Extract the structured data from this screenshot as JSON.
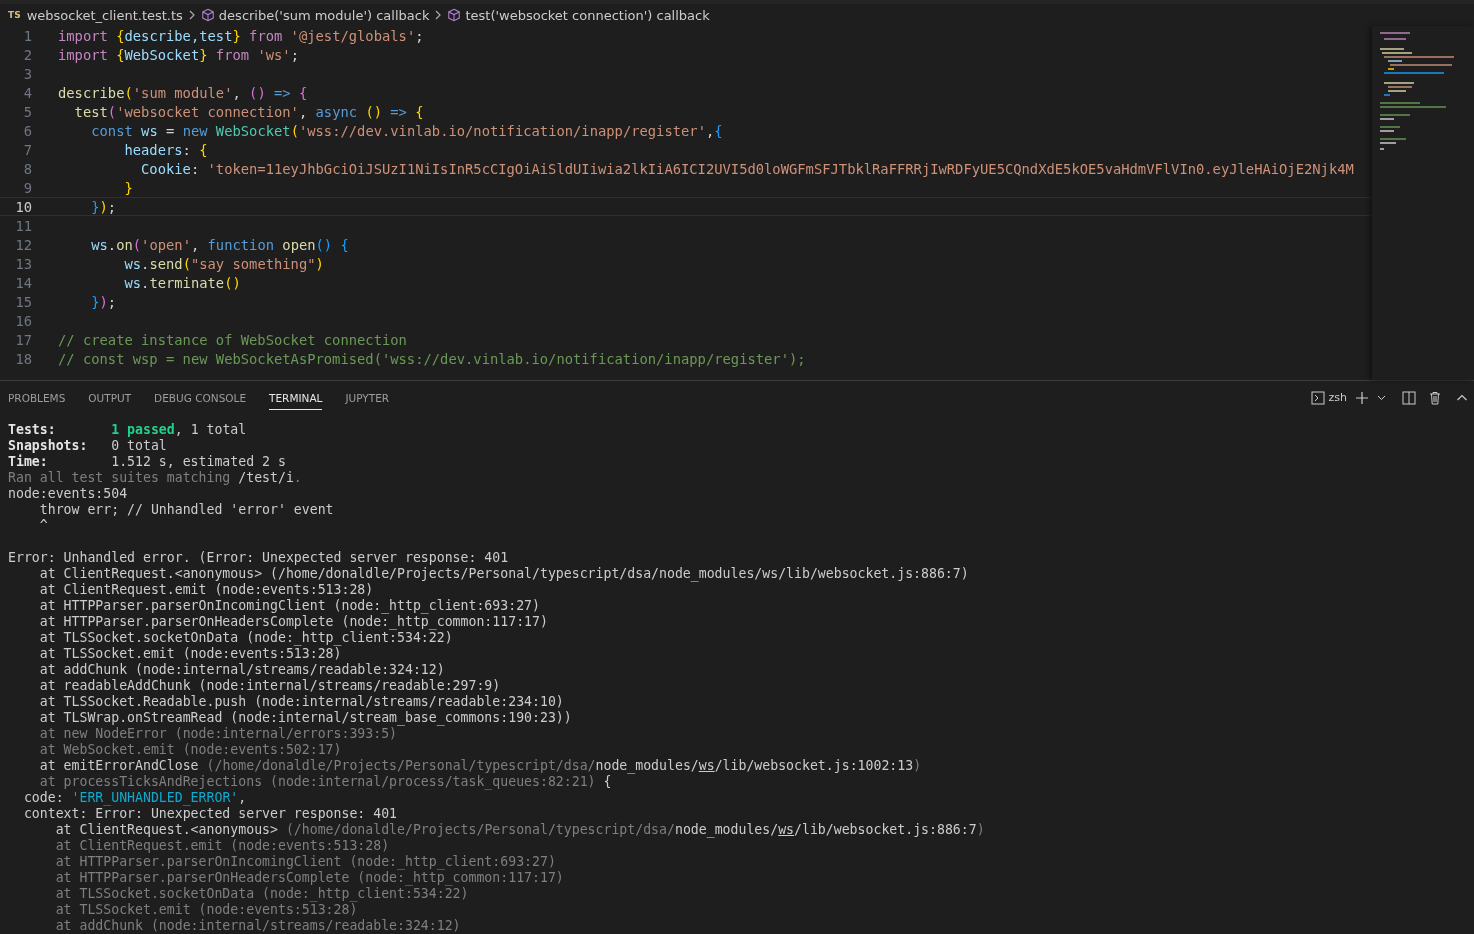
{
  "breadcrumb": {
    "file_badge": "TS",
    "items": [
      {
        "label": "websocket_client.test.ts",
        "kind": "file"
      },
      {
        "label": "describe('sum module') callback",
        "kind": "symbol"
      },
      {
        "label": "test('websocket connection') callback",
        "kind": "symbol"
      }
    ]
  },
  "editor": {
    "lines": [
      {
        "number": "1",
        "current": false,
        "tokens": [
          {
            "t": "import ",
            "kind": "kw"
          },
          {
            "t": "{",
            "kind": "brace"
          },
          {
            "t": "describe,test",
            "kind": "var"
          },
          {
            "t": "}",
            "kind": "brace"
          },
          {
            "t": " from ",
            "kind": "kw"
          },
          {
            "t": "'@jest/globals'",
            "kind": "str"
          },
          {
            "t": ";",
            "kind": "plain"
          }
        ]
      },
      {
        "number": "2",
        "current": false,
        "tokens": [
          {
            "t": "import ",
            "kind": "kw"
          },
          {
            "t": "{",
            "kind": "brace"
          },
          {
            "t": "WebSocket",
            "kind": "var"
          },
          {
            "t": "}",
            "kind": "brace"
          },
          {
            "t": " from ",
            "kind": "kw"
          },
          {
            "t": "'ws'",
            "kind": "str"
          },
          {
            "t": ";",
            "kind": "plain"
          }
        ]
      },
      {
        "number": "3",
        "current": false
      },
      {
        "number": "4",
        "current": false,
        "tokens": [
          {
            "t": "describe",
            "kind": "fn"
          },
          {
            "t": "(",
            "kind": "brace"
          },
          {
            "t": "'sum module'",
            "kind": "str"
          },
          {
            "t": ", ",
            "kind": "plain"
          },
          {
            "t": "()",
            "kind": "paren"
          },
          {
            "t": " => ",
            "kind": "blue"
          },
          {
            "t": "{",
            "kind": "paren"
          }
        ]
      },
      {
        "number": "5",
        "current": false,
        "tokens": [
          {
            "t": "  test",
            "kind": "fn"
          },
          {
            "t": "(",
            "kind": "paren"
          },
          {
            "t": "'websocket connection'",
            "kind": "str"
          },
          {
            "t": ", ",
            "kind": "plain"
          },
          {
            "t": "async ",
            "kind": "blue"
          },
          {
            "t": "()",
            "kind": "brace"
          },
          {
            "t": " => ",
            "kind": "blue"
          },
          {
            "t": "{",
            "kind": "brace"
          }
        ]
      },
      {
        "number": "6",
        "current": false,
        "tokens": [
          {
            "t": "    const ",
            "kind": "blue"
          },
          {
            "t": "ws",
            "kind": "var"
          },
          {
            "t": " = ",
            "kind": "plain"
          },
          {
            "t": "new ",
            "kind": "blue"
          },
          {
            "t": "WebSocket",
            "kind": "cls"
          },
          {
            "t": "(",
            "kind": "brace"
          },
          {
            "t": "'wss://dev.vinlab.io/notification/inapp/register'",
            "kind": "str"
          },
          {
            "t": ",",
            "kind": "plain"
          },
          {
            "t": "{",
            "kind": "bluebr"
          }
        ]
      },
      {
        "number": "7",
        "current": false,
        "tokens": [
          {
            "t": "        headers",
            "kind": "var"
          },
          {
            "t": ": ",
            "kind": "plain"
          },
          {
            "t": "{",
            "kind": "brace"
          }
        ]
      },
      {
        "number": "8",
        "current": false,
        "tokens": [
          {
            "t": "          Cookie",
            "kind": "var"
          },
          {
            "t": ": ",
            "kind": "plain"
          },
          {
            "t": "'token=11eyJhbGciOiJSUzI1NiIsInR5cCIgOiAiSldUIiwia2lkIiA6ICI2UVI5d0loWGFmSFJTbklRaFFRRjIwRDFyUE5CQndXdE5kOE5vaHdmVFlVIn0.eyJleHAiOjE2Njk4M",
            "kind": "str"
          }
        ]
      },
      {
        "number": "9",
        "current": false,
        "tokens": [
          {
            "t": "        }",
            "kind": "brace"
          }
        ]
      },
      {
        "number": "10",
        "current": true,
        "tokens": [
          {
            "t": "    }",
            "kind": "bluebr"
          },
          {
            "t": ")",
            "kind": "brace"
          },
          {
            "t": ";",
            "kind": "plain"
          }
        ]
      },
      {
        "number": "11",
        "current": false
      },
      {
        "number": "12",
        "current": false,
        "tokens": [
          {
            "t": "    ws",
            "kind": "var"
          },
          {
            "t": ".",
            "kind": "plain"
          },
          {
            "t": "on",
            "kind": "fn"
          },
          {
            "t": "(",
            "kind": "paren"
          },
          {
            "t": "'open'",
            "kind": "str"
          },
          {
            "t": ", ",
            "kind": "plain"
          },
          {
            "t": "function ",
            "kind": "blue"
          },
          {
            "t": "open",
            "kind": "fn"
          },
          {
            "t": "() {",
            "kind": "bluebr"
          }
        ]
      },
      {
        "number": "13",
        "current": false,
        "tokens": [
          {
            "t": "        ws",
            "kind": "var"
          },
          {
            "t": ".",
            "kind": "plain"
          },
          {
            "t": "send",
            "kind": "fn"
          },
          {
            "t": "(",
            "kind": "brace"
          },
          {
            "t": "\"say something\"",
            "kind": "str"
          },
          {
            "t": ")",
            "kind": "brace"
          }
        ]
      },
      {
        "number": "14",
        "current": false,
        "tokens": [
          {
            "t": "        ws",
            "kind": "var"
          },
          {
            "t": ".",
            "kind": "plain"
          },
          {
            "t": "terminate",
            "kind": "fn"
          },
          {
            "t": "()",
            "kind": "brace"
          }
        ]
      },
      {
        "number": "15",
        "current": false,
        "tokens": [
          {
            "t": "    }",
            "kind": "bluebr"
          },
          {
            "t": ")",
            "kind": "paren"
          },
          {
            "t": ";",
            "kind": "plain"
          }
        ]
      },
      {
        "number": "16",
        "current": false
      },
      {
        "number": "17",
        "current": false,
        "tokens": [
          {
            "t": "// create instance of WebSocket connection",
            "kind": "comment"
          }
        ]
      },
      {
        "number": "18",
        "current": false,
        "tokens": [
          {
            "t": "// const wsp = new WebSocketAsPromised('wss://dev.vinlab.io/notification/inapp/register');",
            "kind": "comment"
          }
        ]
      }
    ]
  },
  "panel": {
    "tabs": [
      {
        "label": "PROBLEMS",
        "selected": false
      },
      {
        "label": "OUTPUT",
        "selected": false
      },
      {
        "label": "DEBUG CONSOLE",
        "selected": false
      },
      {
        "label": "TERMINAL",
        "selected": true
      },
      {
        "label": "JUPYTER",
        "selected": false
      }
    ],
    "shell": "zsh",
    "lines": [
      {
        "kind": "text",
        "segments": [
          {
            "t": "Tests:       ",
            "kind": "bold"
          },
          {
            "t": "1 passed",
            "kind": "green"
          },
          {
            "t": ", 1 total",
            "kind": "plain"
          }
        ]
      },
      {
        "kind": "text",
        "segments": [
          {
            "t": "Snapshots:   ",
            "kind": "bold"
          },
          {
            "t": "0 total",
            "kind": "plain"
          }
        ]
      },
      {
        "kind": "text",
        "segments": [
          {
            "t": "Time:        ",
            "kind": "bold"
          },
          {
            "t": "1.512 s, estimated 2 s",
            "kind": "plain"
          }
        ]
      },
      {
        "kind": "text",
        "segments": [
          {
            "t": "Ran all test suites matching ",
            "kind": "dim"
          },
          {
            "t": "/test/i",
            "kind": "plain"
          },
          {
            "t": ".",
            "kind": "dim"
          }
        ]
      },
      {
        "kind": "text",
        "segments": [
          {
            "t": "node:events:504",
            "kind": "plain"
          }
        ]
      },
      {
        "kind": "text",
        "segments": [
          {
            "t": "    throw err; // Unhandled 'error' event",
            "kind": "plain"
          }
        ]
      },
      {
        "kind": "text",
        "segments": [
          {
            "t": "    ^",
            "kind": "plain"
          }
        ]
      },
      {
        "kind": "blank"
      },
      {
        "kind": "text",
        "segments": [
          {
            "t": "Error: Unhandled error. (Error: Unexpected server response: 401",
            "kind": "plain"
          }
        ]
      },
      {
        "kind": "text",
        "segments": [
          {
            "t": "    at ClientRequest.<anonymous> (/home/donaldle/Projects/Personal/typescript/dsa/node_modules/ws/lib/websocket.js:886:7)",
            "kind": "plain"
          }
        ]
      },
      {
        "kind": "text",
        "segments": [
          {
            "t": "    at ClientRequest.emit (node:events:513:28)",
            "kind": "plain"
          }
        ]
      },
      {
        "kind": "text",
        "segments": [
          {
            "t": "    at HTTPParser.parserOnIncomingClient (node:_http_client:693:27)",
            "kind": "plain"
          }
        ]
      },
      {
        "kind": "text",
        "segments": [
          {
            "t": "    at HTTPParser.parserOnHeadersComplete (node:_http_common:117:17)",
            "kind": "plain"
          }
        ]
      },
      {
        "kind": "text",
        "segments": [
          {
            "t": "    at TLSSocket.socketOnData (node:_http_client:534:22)",
            "kind": "plain"
          }
        ]
      },
      {
        "kind": "text",
        "segments": [
          {
            "t": "    at TLSSocket.emit (node:events:513:28)",
            "kind": "plain"
          }
        ]
      },
      {
        "kind": "text",
        "segments": [
          {
            "t": "    at addChunk (node:internal/streams/readable:324:12)",
            "kind": "plain"
          }
        ]
      },
      {
        "kind": "text",
        "segments": [
          {
            "t": "    at readableAddChunk (node:internal/streams/readable:297:9)",
            "kind": "plain"
          }
        ]
      },
      {
        "kind": "text",
        "segments": [
          {
            "t": "    at TLSSocket.Readable.push (node:internal/streams/readable:234:10)",
            "kind": "plain"
          }
        ]
      },
      {
        "kind": "text",
        "segments": [
          {
            "t": "    at TLSWrap.onStreamRead (node:internal/stream_base_commons:190:23))",
            "kind": "plain"
          }
        ]
      },
      {
        "kind": "text",
        "segments": [
          {
            "t": "    at new NodeError (node:internal/errors:393:5)",
            "kind": "dim"
          }
        ]
      },
      {
        "kind": "text",
        "segments": [
          {
            "t": "    at WebSocket.emit (node:events:502:17)",
            "kind": "dim"
          }
        ]
      },
      {
        "kind": "text",
        "segments": [
          {
            "t": "    at emitErrorAndClose ",
            "kind": "plain"
          },
          {
            "t": "(/home/donaldle/Projects/Personal/typescript/dsa/",
            "kind": "dim"
          },
          {
            "t": "node_modules/",
            "kind": "plain"
          },
          {
            "t": "ws",
            "kind": "underline"
          },
          {
            "t": "/lib/websocket.js:1002:13",
            "kind": "plain"
          },
          {
            "t": ")",
            "kind": "dim"
          }
        ]
      },
      {
        "kind": "text",
        "segments": [
          {
            "t": "    at processTicksAndRejections (node:internal/process/task_queues:82:21)",
            "kind": "dim"
          },
          {
            "t": " {",
            "kind": "plain"
          }
        ]
      },
      {
        "kind": "text",
        "segments": [
          {
            "t": "  code: ",
            "kind": "plain"
          },
          {
            "t": "'ERR_UNHANDLED_ERROR'",
            "kind": "cyan"
          },
          {
            "t": ",",
            "kind": "plain"
          }
        ]
      },
      {
        "kind": "text",
        "segments": [
          {
            "t": "  context: Error: Unexpected server response: 401",
            "kind": "plain"
          }
        ]
      },
      {
        "kind": "text",
        "segments": [
          {
            "t": "      at ClientRequest.<anonymous> ",
            "kind": "plain"
          },
          {
            "t": "(/home/donaldle/Projects/Personal/typescript/dsa/",
            "kind": "dim"
          },
          {
            "t": "node_modules/",
            "kind": "plain"
          },
          {
            "t": "ws",
            "kind": "underline"
          },
          {
            "t": "/lib/websocket.js:886:7",
            "kind": "plain"
          },
          {
            "t": ")",
            "kind": "dim"
          }
        ]
      },
      {
        "kind": "text",
        "segments": [
          {
            "t": "      at ClientRequest.emit (node:events:513:28)",
            "kind": "dim"
          }
        ]
      },
      {
        "kind": "text",
        "segments": [
          {
            "t": "      at HTTPParser.parserOnIncomingClient (node:_http_client:693:27)",
            "kind": "dim"
          }
        ]
      },
      {
        "kind": "text",
        "segments": [
          {
            "t": "      at HTTPParser.parserOnHeadersComplete (node:_http_common:117:17)",
            "kind": "dim"
          }
        ]
      },
      {
        "kind": "text",
        "segments": [
          {
            "t": "      at TLSSocket.socketOnData (node:_http_client:534:22)",
            "kind": "dim"
          }
        ]
      },
      {
        "kind": "text",
        "segments": [
          {
            "t": "      at TLSSocket.emit (node:events:513:28)",
            "kind": "dim"
          }
        ]
      },
      {
        "kind": "text",
        "segments": [
          {
            "t": "      at addChunk (node:internal/streams/readable:324:12)",
            "kind": "dim"
          }
        ]
      }
    ]
  }
}
